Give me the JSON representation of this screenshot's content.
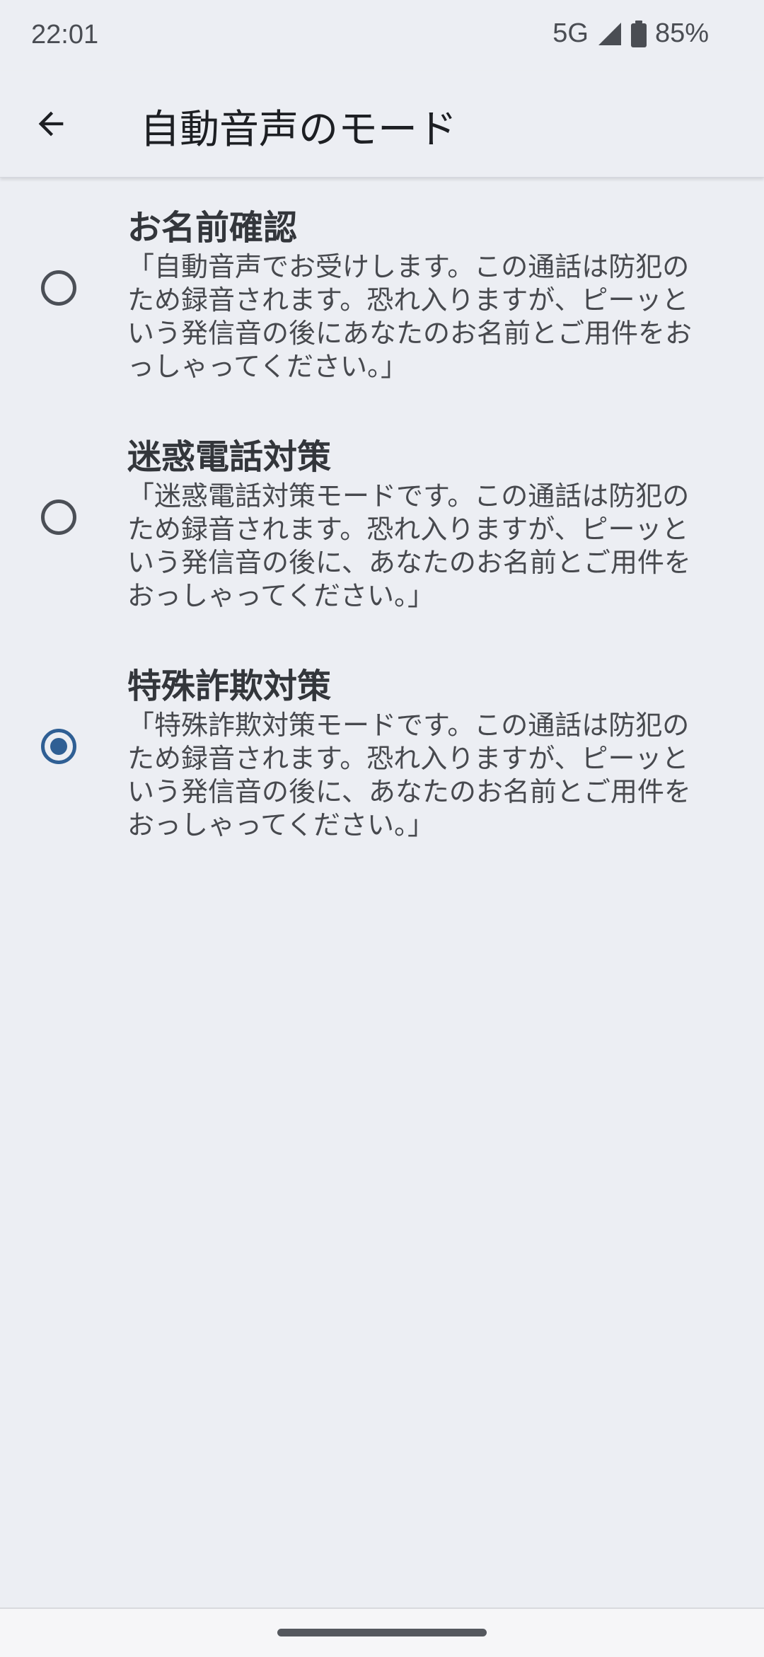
{
  "status_bar": {
    "time": "22:01",
    "network": "5G",
    "battery": "85%"
  },
  "app_bar": {
    "title": "自動音声のモード",
    "back_icon": "arrow-back-icon"
  },
  "options": [
    {
      "title": "お名前確認",
      "description": "「自動音声でお受けします。この通話は防犯のため録音されます。恐れ入りますが、ピーッという発信音の後にあなたのお名前とご用件をおっしゃってください。」",
      "selected": false
    },
    {
      "title": "迷惑電話対策",
      "description": "「迷惑電話対策モードです。この通話は防犯のため録音されます。恐れ入りますが、ピーッという発信音の後に、あなたのお名前とご用件をおっしゃってください。」",
      "selected": false
    },
    {
      "title": "特殊詐欺対策",
      "description": "「特殊詐欺対策モードです。この通話は防犯のため録音されます。恐れ入りますが、ピーッという発信音の後に、あなたのお名前とご用件をおっしゃってください。」",
      "selected": true
    }
  ],
  "colors": {
    "background": "#eceef3",
    "accent": "#2f5f94",
    "radio_unselected": "#4b4f56"
  }
}
